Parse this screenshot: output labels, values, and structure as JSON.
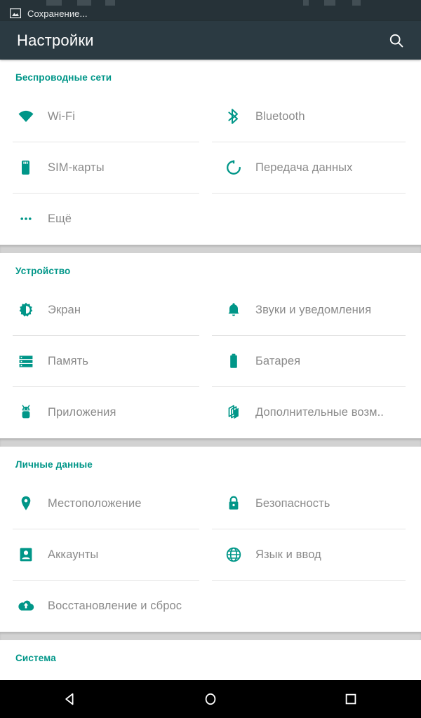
{
  "status_bar": {
    "notification_icon": "image-icon",
    "notification_text": "Сохранение..."
  },
  "appbar": {
    "title": "Настройки",
    "search_icon": "search-icon"
  },
  "colors": {
    "accent": "#009688",
    "appbar_bg": "#2b3a42",
    "statusbar_bg": "#263238",
    "label": "#8a8a8a",
    "navbar_bg": "#000000",
    "divider": "#e4e4e4",
    "band": "#d2d2d2"
  },
  "sections": [
    {
      "title": "Беспроводные сети",
      "items": [
        {
          "label": "Wi-Fi",
          "icon": "wifi-icon"
        },
        {
          "label": "Bluetooth",
          "icon": "bluetooth-icon"
        },
        {
          "label": "SIM-карты",
          "icon": "sim-card-icon"
        },
        {
          "label": "Передача данных",
          "icon": "data-usage-icon"
        },
        {
          "label": "Ещё",
          "icon": "more-dots-icon"
        }
      ]
    },
    {
      "title": "Устройство",
      "items": [
        {
          "label": "Экран",
          "icon": "brightness-icon"
        },
        {
          "label": "Звуки и уведомления",
          "icon": "bell-icon"
        },
        {
          "label": "Память",
          "icon": "storage-icon"
        },
        {
          "label": "Батарея",
          "icon": "battery-icon"
        },
        {
          "label": "Приложения",
          "icon": "android-icon"
        },
        {
          "label": "Дополнительные возм..",
          "icon": "extras-icon"
        }
      ]
    },
    {
      "title": "Личные данные",
      "items": [
        {
          "label": "Местоположение",
          "icon": "location-pin-icon"
        },
        {
          "label": "Безопасность",
          "icon": "lock-icon"
        },
        {
          "label": "Аккаунты",
          "icon": "account-icon"
        },
        {
          "label": "Язык и ввод",
          "icon": "globe-icon"
        },
        {
          "label": "Восстановление и сброс",
          "icon": "backup-cloud-icon"
        }
      ]
    },
    {
      "title": "Система",
      "items": []
    }
  ],
  "navbar": {
    "back_icon": "back-triangle-icon",
    "home_icon": "home-circle-icon",
    "recents_icon": "recents-square-icon"
  }
}
